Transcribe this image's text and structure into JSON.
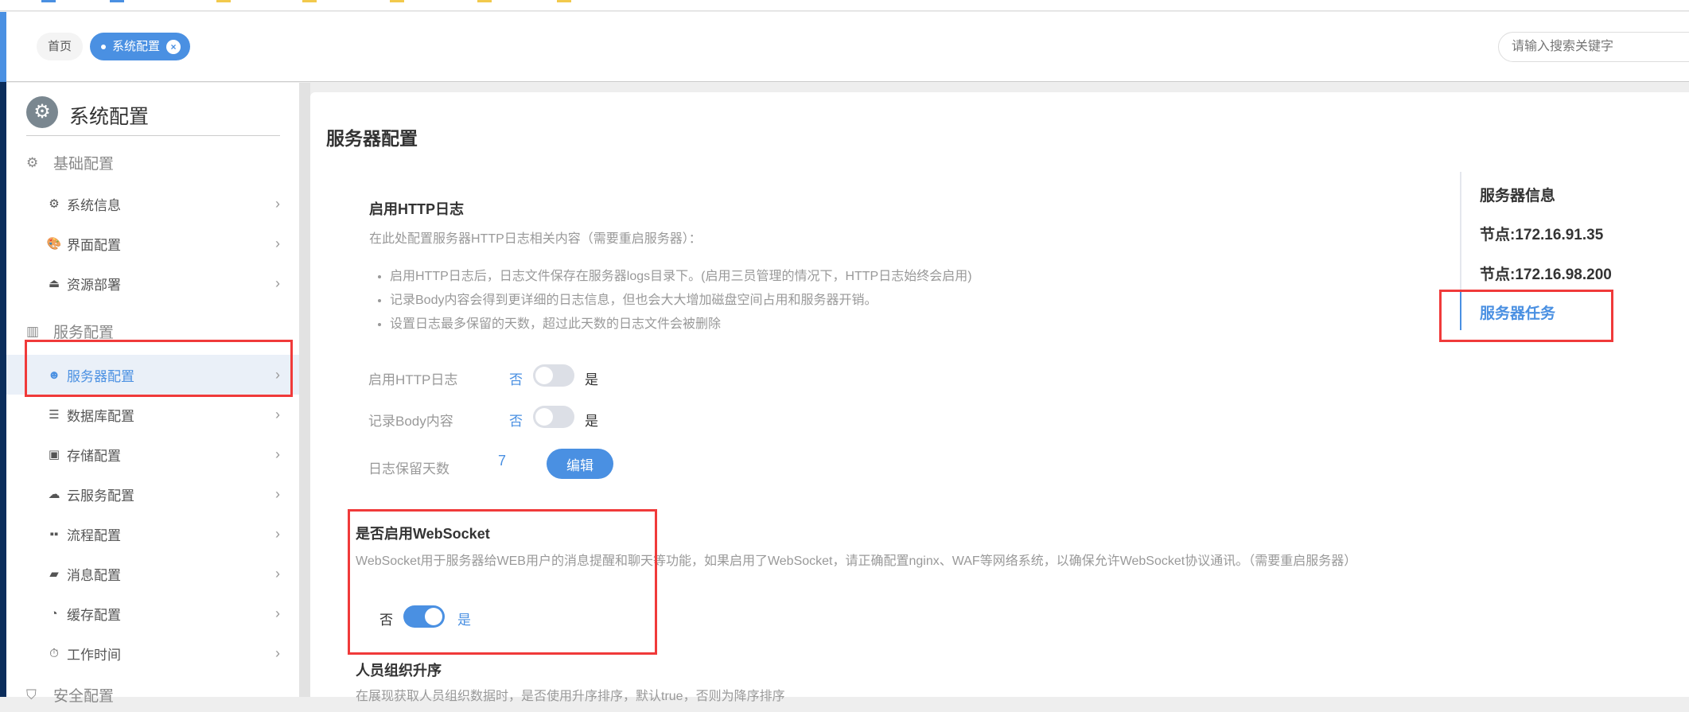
{
  "header": {
    "tabs": [
      {
        "label": "首页"
      },
      {
        "label": "系统配置",
        "close": "×"
      }
    ],
    "search_placeholder": "请输入搜索关键字"
  },
  "sidebar": {
    "title": "系统配置",
    "groups": [
      {
        "label": "基础配置",
        "items": [
          {
            "label": "系统信息"
          },
          {
            "label": "界面配置"
          },
          {
            "label": "资源部署"
          }
        ]
      },
      {
        "label": "服务配置",
        "items": [
          {
            "label": "服务器配置"
          },
          {
            "label": "数据库配置"
          },
          {
            "label": "存储配置"
          },
          {
            "label": "云服务配置"
          },
          {
            "label": "流程配置"
          },
          {
            "label": "消息配置"
          },
          {
            "label": "缓存配置"
          },
          {
            "label": "工作时间"
          }
        ]
      },
      {
        "label": "安全配置"
      }
    ],
    "active": "服务器配置"
  },
  "main": {
    "title": "服务器配置",
    "http_log": {
      "title": "启用HTTP日志",
      "desc": "在此处配置服务器HTTP日志相关内容（需要重启服务器）：",
      "bullets": [
        "启用HTTP日志后，日志文件保存在服务器logs目录下。(启用三员管理的情况下，HTTP日志始终会启用)",
        "记录Body内容会得到更详细的日志信息，但也会大大增加磁盘空间占用和服务器开销。",
        "设置日志最多保留的天数，超过此天数的日志文件会被删除"
      ],
      "enable_label": "启用HTTP日志",
      "body_label": "记录Body内容",
      "days_label": "日志保留天数",
      "days_value": "7",
      "edit_label": "编辑",
      "no": "否",
      "yes": "是",
      "enable_on": false,
      "body_on": false
    },
    "websocket": {
      "title": "是否启用WebSocket",
      "desc": "WebSocket用于服务器给WEB用户的消息提醒和聊天等功能，如果启用了WebSocket，请正确配置nginx、WAF等网络系统，以确保允许WebSocket协议通讯。（需要重启服务器）",
      "no": "否",
      "yes": "是",
      "on": true
    },
    "org_sort": {
      "title": "人员组织升序",
      "desc": "在展现获取人员组织数据时，是否使用升序排序，默认true，否则为降序排序"
    }
  },
  "right_nav": {
    "items": [
      "服务器信息",
      "节点:172.16.91.35",
      "节点:172.16.98.200",
      "服务器任务"
    ],
    "active": "服务器任务"
  },
  "colors": {
    "accent": "#4a90e2",
    "nav_dark": "#0b2d5b",
    "highlight": "#f03a3a"
  }
}
